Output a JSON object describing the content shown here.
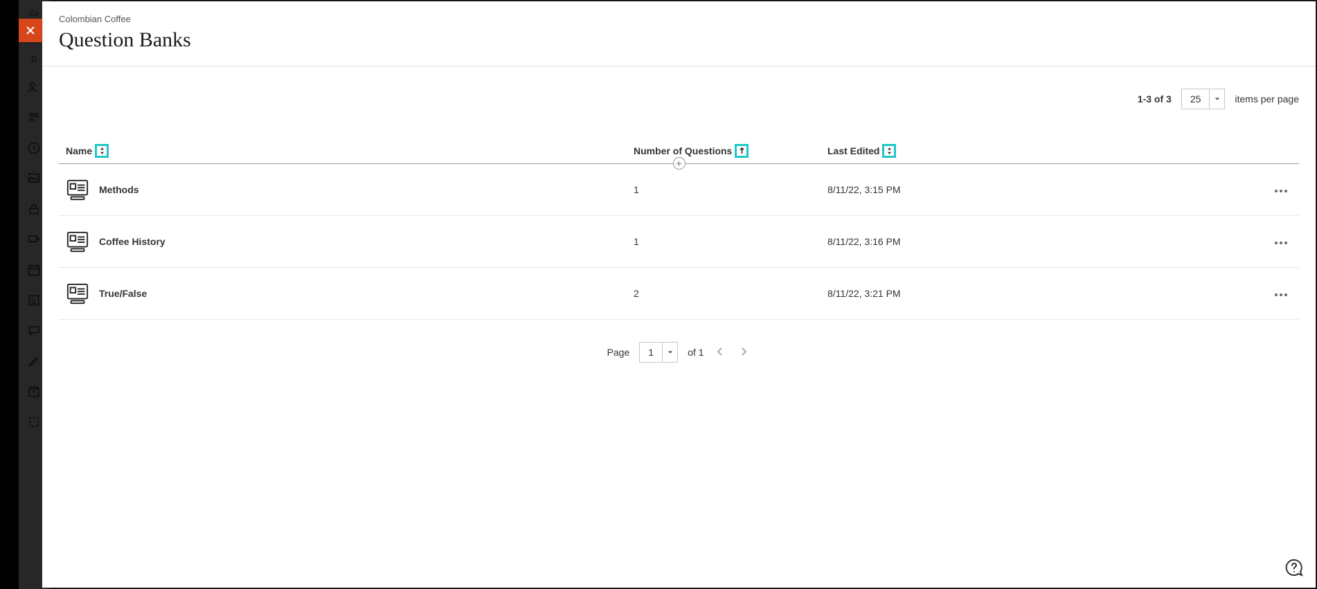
{
  "bgSidebar": {
    "item0": "Co",
    "item1": "D"
  },
  "header": {
    "breadcrumb": "Colombian Coffee",
    "title": "Question Banks"
  },
  "pagerTop": {
    "countText": "1-3 of 3",
    "perPageValue": "25",
    "perPageLabel": "items per page"
  },
  "table": {
    "headers": {
      "name": "Name",
      "num": "Number of Questions",
      "date": "Last Edited"
    },
    "rows": [
      {
        "name": "Methods",
        "num": "1",
        "date": "8/11/22, 3:15 PM"
      },
      {
        "name": "Coffee History",
        "num": "1",
        "date": "8/11/22, 3:16 PM"
      },
      {
        "name": "True/False",
        "num": "2",
        "date": "8/11/22, 3:21 PM"
      }
    ]
  },
  "pagerBottom": {
    "pageLabel": "Page",
    "pageValue": "1",
    "ofText": "of 1"
  }
}
